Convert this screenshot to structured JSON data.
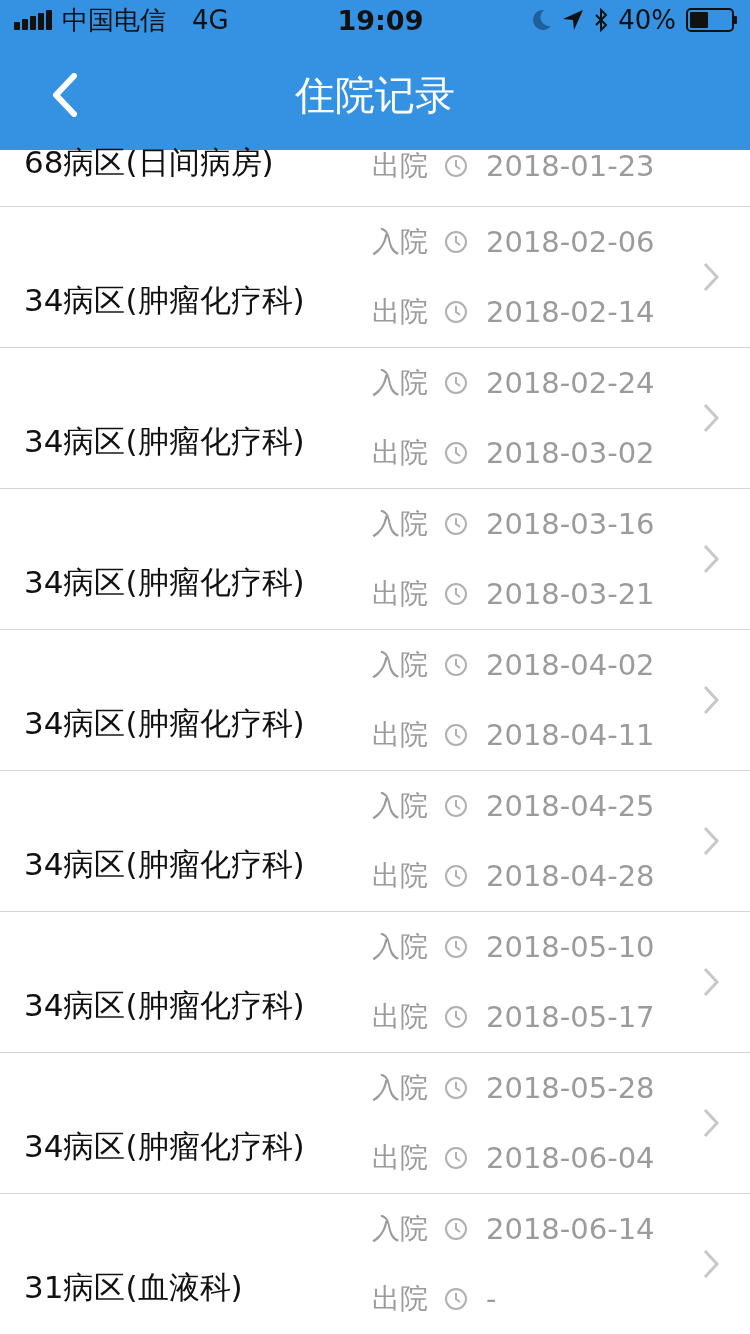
{
  "status_bar": {
    "carrier": "中国电信",
    "network": "4G",
    "time": "19:09",
    "battery": "40%"
  },
  "nav": {
    "title": "住院记录"
  },
  "records": [
    {
      "ward": "68病区(日间病房)",
      "discharge_label": "出院",
      "discharge": "2018-01-23"
    },
    {
      "ward": "34病区(肿瘤化疗科)",
      "admit_label": "入院",
      "admit": "2018-02-06",
      "discharge_label": "出院",
      "discharge": "2018-02-14"
    },
    {
      "ward": "34病区(肿瘤化疗科)",
      "admit_label": "入院",
      "admit": "2018-02-24",
      "discharge_label": "出院",
      "discharge": "2018-03-02"
    },
    {
      "ward": "34病区(肿瘤化疗科)",
      "admit_label": "入院",
      "admit": "2018-03-16",
      "discharge_label": "出院",
      "discharge": "2018-03-21"
    },
    {
      "ward": "34病区(肿瘤化疗科)",
      "admit_label": "入院",
      "admit": "2018-04-02",
      "discharge_label": "出院",
      "discharge": "2018-04-11"
    },
    {
      "ward": "34病区(肿瘤化疗科)",
      "admit_label": "入院",
      "admit": "2018-04-25",
      "discharge_label": "出院",
      "discharge": "2018-04-28"
    },
    {
      "ward": "34病区(肿瘤化疗科)",
      "admit_label": "入院",
      "admit": "2018-05-10",
      "discharge_label": "出院",
      "discharge": "2018-05-17"
    },
    {
      "ward": "34病区(肿瘤化疗科)",
      "admit_label": "入院",
      "admit": "2018-05-28",
      "discharge_label": "出院",
      "discharge": "2018-06-04"
    },
    {
      "ward": "31病区(血液科)",
      "admit_label": "入院",
      "admit": "2018-06-14",
      "discharge_label": "出院",
      "discharge": "-"
    }
  ]
}
